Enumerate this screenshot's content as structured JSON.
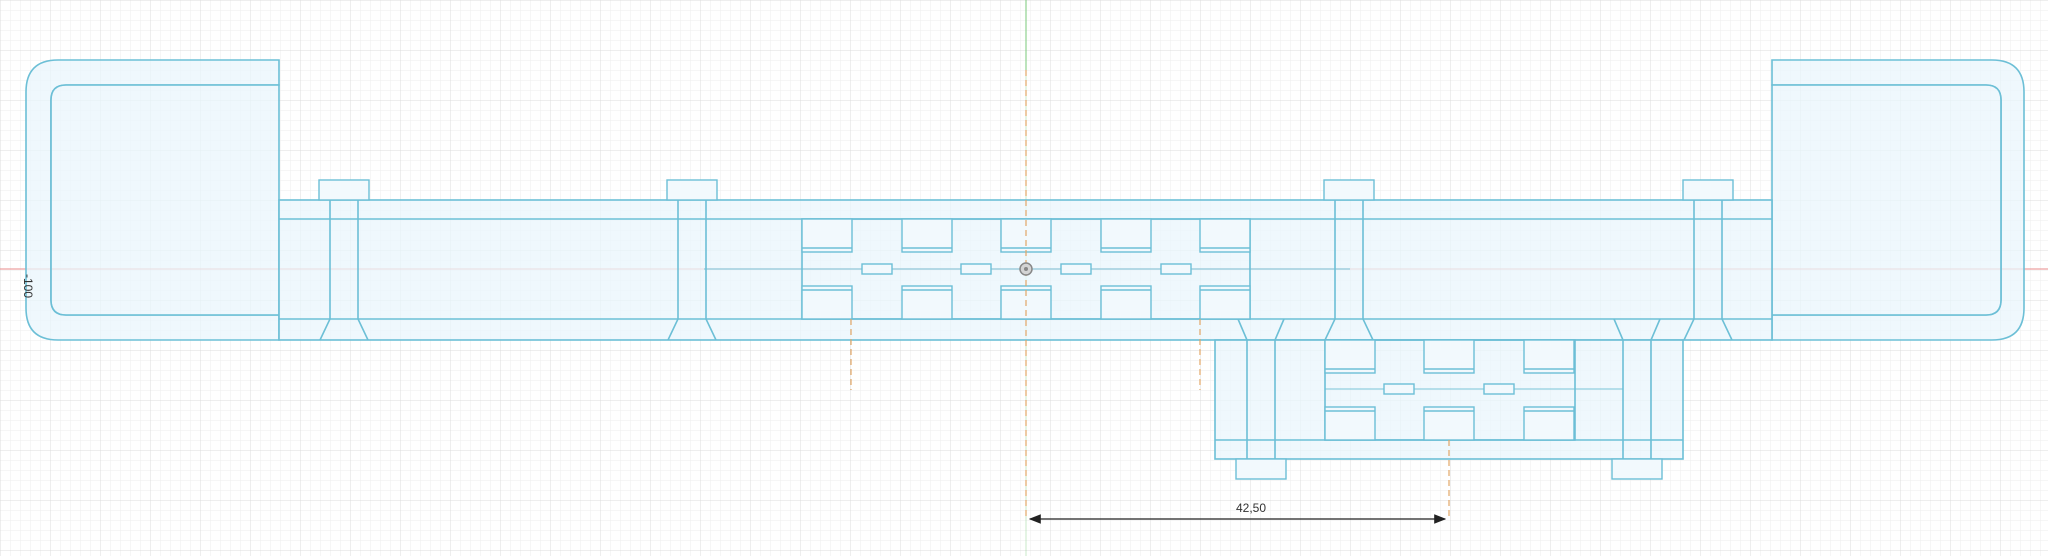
{
  "sketch": {
    "dimension_vertical": "-100",
    "dimension_horizontal": "42,50"
  },
  "colors": {
    "background": "#ffffff",
    "grid_minor": "#eeeeee",
    "grid_major": "#dddddd",
    "sketch_line": "#6cbfd6",
    "sketch_fill": "#eaf5fc",
    "axis_x": "#e98a8a",
    "axis_y": "#79c879",
    "construction_line": "#e2a666",
    "dimension_line": "#222222"
  },
  "icons": {
    "origin": "origin-icon"
  }
}
